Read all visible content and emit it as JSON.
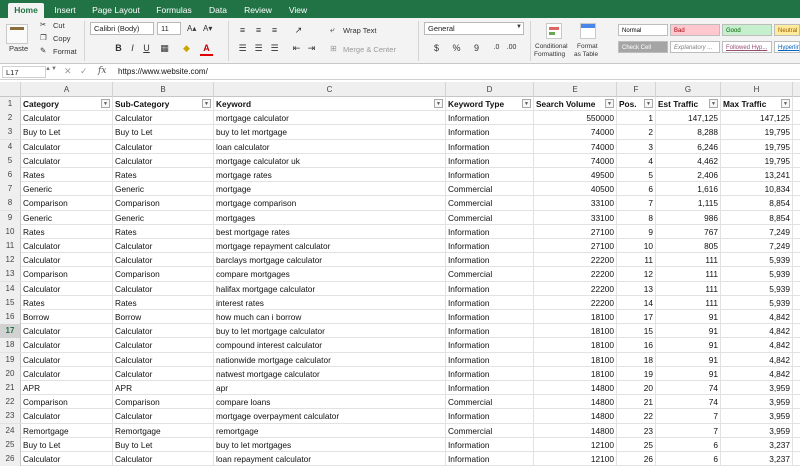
{
  "ribbon_tabs": [
    "Home",
    "Insert",
    "Page Layout",
    "Formulas",
    "Data",
    "Review",
    "View"
  ],
  "clipboard": {
    "cut": "Cut",
    "copy": "Copy",
    "format": "Format",
    "paste": "Paste"
  },
  "font": {
    "name": "Calibri (Body)",
    "size": "11",
    "grow": "A▴",
    "shrink": "A▾"
  },
  "alignment": {
    "wrap_text": "Wrap Text",
    "merge_center": "Merge & Center"
  },
  "number": {
    "format": "General",
    "currency": "$",
    "percent": "%",
    "comma": "9"
  },
  "styles_group": {
    "conditional": [
      "Conditional",
      "Formatting"
    ],
    "format_as_table": [
      "Format",
      "as Table"
    ]
  },
  "cell_styles": [
    {
      "label": "Normal",
      "bg": "#ffffff",
      "fg": "#000000"
    },
    {
      "label": "Bad",
      "bg": "#ffc7ce",
      "fg": "#9c0006"
    },
    {
      "label": "Good",
      "bg": "#c6efce",
      "fg": "#006100"
    },
    {
      "label": "Neutral",
      "bg": "#ffeb9c",
      "fg": "#9c5700"
    },
    {
      "label": "Check Cell",
      "bg": "#a5a5a5",
      "fg": "#ffffff"
    },
    {
      "label": "Explanatory ...",
      "bg": "#ffffff",
      "fg": "#7f7f7f"
    },
    {
      "label": "Followed Hyp...",
      "bg": "#ffffff",
      "fg": "#954f72"
    },
    {
      "label": "Hyperlink",
      "bg": "#ffffff",
      "fg": "#0563c1"
    }
  ],
  "formula_bar": {
    "name_box": "L17",
    "fx": "fx",
    "value": "https://www.website.com/"
  },
  "columns": [
    "A",
    "B",
    "C",
    "D",
    "E",
    "F",
    "G",
    "H"
  ],
  "selected_row": "17",
  "headers": [
    "Category",
    "Sub-Category",
    "Keyword",
    "Keyword Type",
    "Search Volume",
    "Pos.",
    "Est Traffic",
    "Max Traffic"
  ],
  "rows": [
    [
      "2",
      "Calculator",
      "Calculator",
      "mortgage calculator",
      "Information",
      "550000",
      "1",
      "147,125",
      "147,125"
    ],
    [
      "3",
      "Buy to Let",
      "Buy to Let",
      "buy to let mortgage",
      "Information",
      "74000",
      "2",
      "8,288",
      "19,795"
    ],
    [
      "4",
      "Calculator",
      "Calculator",
      "loan calculator",
      "Information",
      "74000",
      "3",
      "6,246",
      "19,795"
    ],
    [
      "5",
      "Calculator",
      "Calculator",
      "mortgage calculator uk",
      "Information",
      "74000",
      "4",
      "4,462",
      "19,795"
    ],
    [
      "6",
      "Rates",
      "Rates",
      "mortgage rates",
      "Information",
      "49500",
      "5",
      "2,406",
      "13,241"
    ],
    [
      "7",
      "Generic",
      "Generic",
      "mortgage",
      "Commercial",
      "40500",
      "6",
      "1,616",
      "10,834"
    ],
    [
      "8",
      "Comparison",
      "Comparison",
      "mortgage comparison",
      "Commercial",
      "33100",
      "7",
      "1,115",
      "8,854"
    ],
    [
      "9",
      "Generic",
      "Generic",
      "mortgages",
      "Commercial",
      "33100",
      "8",
      "986",
      "8,854"
    ],
    [
      "10",
      "Rates",
      "Rates",
      "best mortgage rates",
      "Information",
      "27100",
      "9",
      "767",
      "7,249"
    ],
    [
      "11",
      "Calculator",
      "Calculator",
      "mortgage repayment calculator",
      "Information",
      "27100",
      "10",
      "805",
      "7,249"
    ],
    [
      "12",
      "Calculator",
      "Calculator",
      "barclays mortgage calculator",
      "Information",
      "22200",
      "11",
      "111",
      "5,939"
    ],
    [
      "13",
      "Comparison",
      "Comparison",
      "compare mortgages",
      "Commercial",
      "22200",
      "12",
      "111",
      "5,939"
    ],
    [
      "14",
      "Calculator",
      "Calculator",
      "halifax mortgage calculator",
      "Information",
      "22200",
      "13",
      "111",
      "5,939"
    ],
    [
      "15",
      "Rates",
      "Rates",
      "interest rates",
      "Information",
      "22200",
      "14",
      "111",
      "5,939"
    ],
    [
      "16",
      "Borrow",
      "Borrow",
      "how much can i borrow",
      "Information",
      "18100",
      "17",
      "91",
      "4,842"
    ],
    [
      "17",
      "Calculator",
      "Calculator",
      "buy to let mortgage calculator",
      "Information",
      "18100",
      "15",
      "91",
      "4,842"
    ],
    [
      "18",
      "Calculator",
      "Calculator",
      "compound interest calculator",
      "Information",
      "18100",
      "16",
      "91",
      "4,842"
    ],
    [
      "19",
      "Calculator",
      "Calculator",
      "nationwide mortgage calculator",
      "Information",
      "18100",
      "18",
      "91",
      "4,842"
    ],
    [
      "20",
      "Calculator",
      "Calculator",
      "natwest mortgage calculator",
      "Information",
      "18100",
      "19",
      "91",
      "4,842"
    ],
    [
      "21",
      "APR",
      "APR",
      "apr",
      "Information",
      "14800",
      "20",
      "74",
      "3,959"
    ],
    [
      "22",
      "Comparison",
      "Comparison",
      "compare loans",
      "Commercial",
      "14800",
      "21",
      "74",
      "3,959"
    ],
    [
      "23",
      "Calculator",
      "Calculator",
      "mortgage overpayment calculator",
      "Information",
      "14800",
      "22",
      "7",
      "3,959"
    ],
    [
      "24",
      "Remortgage",
      "Remortgage",
      "remortgage",
      "Commercial",
      "14800",
      "23",
      "7",
      "3,959"
    ],
    [
      "25",
      "Buy to Let",
      "Buy to Let",
      "buy to let mortgages",
      "Information",
      "12100",
      "25",
      "6",
      "3,237"
    ],
    [
      "26",
      "Calculator",
      "Calculator",
      "loan repayment calculator",
      "Information",
      "12100",
      "26",
      "6",
      "3,237"
    ]
  ]
}
